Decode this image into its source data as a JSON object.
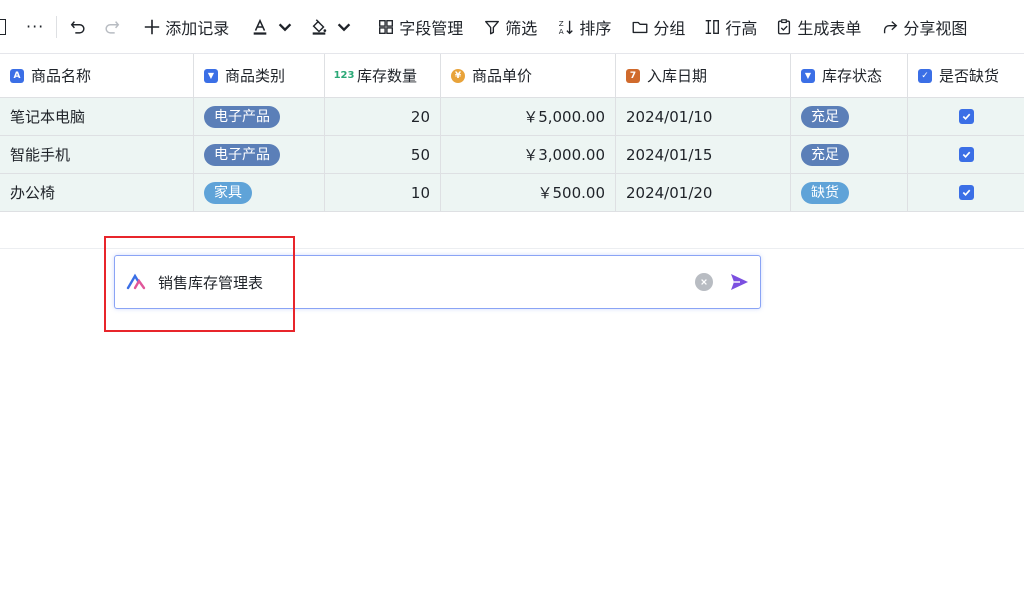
{
  "toolbar": {
    "more_label": "···",
    "add_record": "添加记录",
    "field_manage": "字段管理",
    "filter": "筛选",
    "sort": "排序",
    "group": "分组",
    "row_height": "行高",
    "generate_form": "生成表单",
    "share_view": "分享视图"
  },
  "table": {
    "headers": [
      {
        "label": "商品名称",
        "icon": "text-field-icon",
        "icon_char": "A",
        "color": "#3b6fe6"
      },
      {
        "label": "商品类别",
        "icon": "select-field-icon",
        "icon_char": "▾",
        "color": "#3b6fe6"
      },
      {
        "label": "库存数量",
        "icon": "number-field-icon",
        "icon_char": "123",
        "color": "#2aa876"
      },
      {
        "label": "商品单价",
        "icon": "currency-field-icon",
        "icon_char": "¥",
        "color": "#e8a33a"
      },
      {
        "label": "入库日期",
        "icon": "date-field-icon",
        "icon_char": "7",
        "color": "#d06a2c"
      },
      {
        "label": "库存状态",
        "icon": "select-field-icon",
        "icon_char": "▾",
        "color": "#3b6fe6"
      },
      {
        "label": "是否缺货",
        "icon": "checkbox-field-icon",
        "icon_char": "✓",
        "color": "#3b6fe6"
      }
    ],
    "rows": [
      {
        "name": "笔记本电脑",
        "category": "电子产品",
        "category_color": "#5b7fb8",
        "qty": "20",
        "price": "￥5,000.00",
        "date": "2024/01/10",
        "status": "充足",
        "status_color": "#5b7fb8",
        "out_of_stock": true
      },
      {
        "name": "智能手机",
        "category": "电子产品",
        "category_color": "#5b7fb8",
        "qty": "50",
        "price": "￥3,000.00",
        "date": "2024/01/15",
        "status": "充足",
        "status_color": "#5b7fb8",
        "out_of_stock": true
      },
      {
        "name": "办公椅",
        "category": "家具",
        "category_color": "#5fa3d8",
        "qty": "10",
        "price": "￥500.00",
        "date": "2024/01/20",
        "status": "缺货",
        "status_color": "#5fa3d8",
        "out_of_stock": true
      }
    ]
  },
  "ai_input": {
    "value": "销售库存管理表"
  },
  "colors": {
    "accent": "#3b6fe6",
    "highlight": "#e8252b",
    "send": "#7b4fe0"
  }
}
